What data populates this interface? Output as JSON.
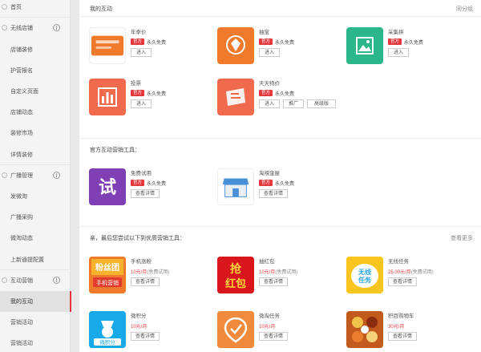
{
  "sidebar": {
    "items": [
      {
        "label": "首页",
        "type": "group"
      },
      {
        "label": "无线店铺",
        "type": "group"
      },
      {
        "label": "店铺装修",
        "type": "item"
      },
      {
        "label": "护营报名",
        "type": "item"
      },
      {
        "label": "自定义页面",
        "type": "item"
      },
      {
        "label": "店铺动态",
        "type": "item"
      },
      {
        "label": "装修市场",
        "type": "item"
      },
      {
        "label": "详情装修",
        "type": "item"
      },
      {
        "label": "广播管理",
        "type": "group"
      },
      {
        "label": "发微淘",
        "type": "item"
      },
      {
        "label": "广播采购",
        "type": "item"
      },
      {
        "label": "微淘动态",
        "type": "item"
      },
      {
        "label": "上新通提配置",
        "type": "item"
      },
      {
        "label": "互动营销",
        "type": "group"
      },
      {
        "label": "我的互动",
        "type": "item",
        "active": true
      },
      {
        "label": "营销活动",
        "type": "item"
      },
      {
        "label": "营销活动",
        "type": "item"
      }
    ]
  },
  "main": {
    "my_section": {
      "title": "我的互动",
      "right_link": "同分组"
    },
    "my_tools": [
      {
        "name": "年季价",
        "tag": "官方",
        "tag_text": "永久免费",
        "buttons": [
          "进入"
        ],
        "color": "#f07a2c",
        "icon": "card-icon"
      },
      {
        "name": "抽宝",
        "tag": "官方",
        "tag_text": "永久免费",
        "buttons": [
          "进入"
        ],
        "color": "#f07a2c",
        "icon": "prize-icon"
      },
      {
        "name": "采集拼",
        "tag": "官方",
        "tag_text": "永久免费",
        "buttons": [
          "进入"
        ],
        "color": "#2bb78a",
        "icon": "image-icon"
      },
      {
        "name": "投票",
        "tag": "官方",
        "tag_text": "永久免费",
        "buttons": [
          "进入"
        ],
        "color": "#f06b4e",
        "icon": "chart-icon"
      },
      {
        "name": "天天特价",
        "tag": "官方",
        "tag_text": "永久免费",
        "buttons": [
          "进入",
          "推广",
          "高级版"
        ],
        "color": "#f06b4e",
        "icon": "ticket-icon"
      }
    ],
    "official_section": {
      "title": "官方互动营销工具："
    },
    "official_tools": [
      {
        "name": "免费试用",
        "tag": "官方",
        "tag_text": "永久免费",
        "buttons": [
          "查看详情"
        ],
        "color": "#7f3fb5",
        "icon": "try-icon",
        "glyph": "试"
      },
      {
        "name": "淘辣金屋",
        "tag": "官方",
        "tag_text": "永久免费",
        "buttons": [
          "查看详情"
        ],
        "color": "#ffffff",
        "icon": "store-icon"
      }
    ],
    "recommend_section": {
      "title": "亲，最后您尝试以下到优质营销工具：",
      "right_link": "查看更多"
    },
    "recommend_tools": [
      {
        "name": "手机涨粉",
        "price": "10元/月",
        "price_sub": "(免费试用)",
        "buttons": [
          "查看详情"
        ],
        "color": "#f07a2c",
        "icon": "fans-icon",
        "top": "粉丝团",
        "bottom": "手机营销"
      },
      {
        "name": "抽红包",
        "price": "10元/月",
        "price_sub": "(免费试用)",
        "buttons": [
          "查看详情"
        ],
        "color": "#d9161b",
        "icon": "redpacket-icon",
        "top": "抢",
        "bottom": "红包"
      },
      {
        "name": "无线任务",
        "price": "25.00元/月",
        "price_sub": "(免费试用)",
        "buttons": [
          "查看详情"
        ],
        "color": "#f7c51e",
        "icon": "task-icon",
        "top": "无线",
        "bottom": "任务"
      },
      {
        "name": "微积分",
        "price": "10元/月",
        "price_sub": "",
        "buttons": [
          "查看详情"
        ],
        "color": "#18a9e8",
        "icon": "points-icon",
        "top": "",
        "bottom": "微积分"
      },
      {
        "name": "微淘任务",
        "price": "10元/月",
        "price_sub": "",
        "buttons": [
          "查看详情"
        ],
        "color": "#f08a3c",
        "icon": "badge-icon",
        "top": "",
        "bottom": ""
      },
      {
        "name": "积目购物车",
        "price": "30元/月",
        "price_sub": "",
        "buttons": [
          "查看详情"
        ],
        "color": "#e8a020",
        "icon": "food-icon",
        "top": "",
        "bottom": ""
      }
    ]
  }
}
